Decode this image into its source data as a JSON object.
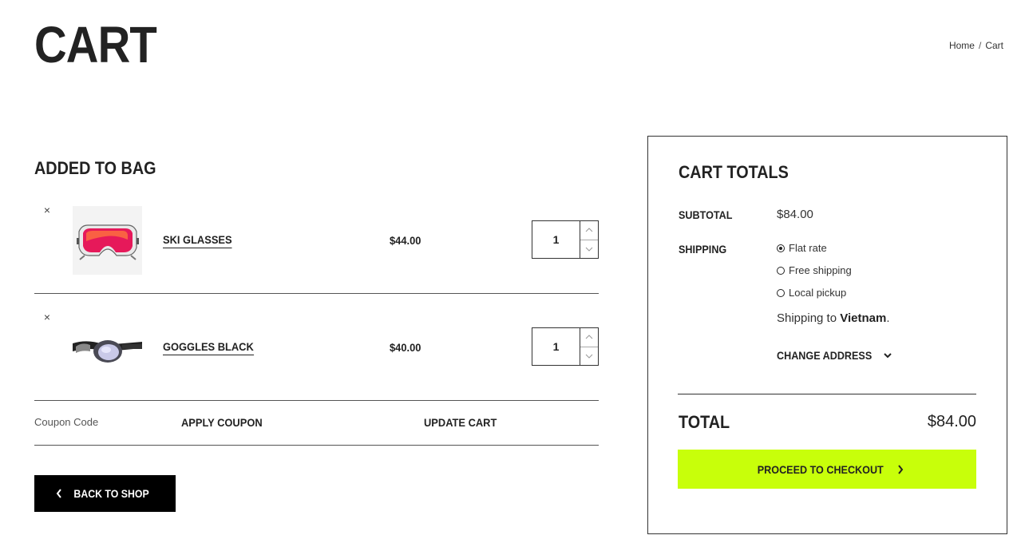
{
  "page": {
    "title": "CART"
  },
  "breadcrumb": {
    "home": "Home",
    "separator": "/",
    "current": "Cart"
  },
  "bag": {
    "title": "ADDED TO BAG",
    "items": [
      {
        "remove": "×",
        "name": "SKI GLASSES",
        "price": "$44.00",
        "qty": "1",
        "image_icon": "ski-goggles-image"
      },
      {
        "remove": "×",
        "name": "GOGGLES BLACK",
        "price": "$40.00",
        "qty": "1",
        "image_icon": "swim-goggles-image"
      }
    ]
  },
  "coupon": {
    "placeholder": "Coupon Code",
    "apply_label": "APPLY COUPON",
    "update_label": "UPDATE CART"
  },
  "back_button": {
    "label": "BACK TO SHOP"
  },
  "totals": {
    "title": "CART TOTALS",
    "subtotal_label": "SUBTOTAL",
    "subtotal_value": "$84.00",
    "shipping_label": "SHIPPING",
    "shipping_options": [
      {
        "label": "Flat rate",
        "selected": true
      },
      {
        "label": "Free shipping",
        "selected": false
      },
      {
        "label": "Local pickup",
        "selected": false
      }
    ],
    "shipping_to_prefix": "Shipping to",
    "shipping_to_country": "Vietnam",
    "shipping_to_suffix": ".",
    "change_address_label": "CHANGE ADDRESS",
    "total_label": "TOTAL",
    "total_value": "$84.00",
    "checkout_label": "PROCEED TO CHECKOUT"
  },
  "colors": {
    "accent": "#c8ff0a",
    "dark": "#000000",
    "text": "#222222"
  }
}
